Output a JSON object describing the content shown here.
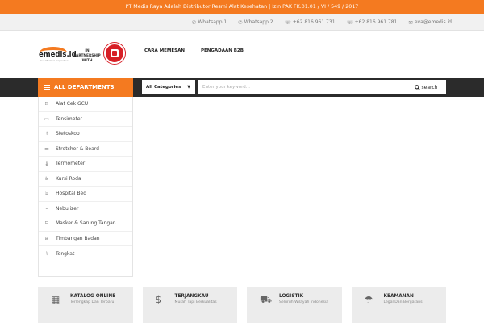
{
  "topbar": {
    "text": "PT Medis Raya Adalah Distributor Resmi Alat Kesehatan | Izin PAK FK.01.01 / VI / 549 / 2017"
  },
  "contacts": [
    {
      "icon": "whatsapp-icon",
      "glyph": "✆",
      "label": "Whatsapp 1"
    },
    {
      "icon": "whatsapp-icon",
      "glyph": "✆",
      "label": "Whatsapp 2"
    },
    {
      "icon": "phone-icon",
      "glyph": "☏",
      "label": "+62 816 961 731"
    },
    {
      "icon": "phone-icon",
      "glyph": "☏",
      "label": "+62 816 961 781"
    },
    {
      "icon": "mail-icon",
      "glyph": "✉",
      "label": "eva@emedis.id"
    }
  ],
  "logo": {
    "word": "emedis.id",
    "tagline": "Your Medical Inspiration"
  },
  "partner": {
    "line1": "IN PARTNERSHIP",
    "line2": "WITH"
  },
  "nav": [
    {
      "label": "CARA MEMESAN"
    },
    {
      "label": "PENGADAAN B2B"
    }
  ],
  "departments": {
    "label": "ALL DEPARTMENTS"
  },
  "search": {
    "category": "All Categories",
    "placeholder": "Enter your keyword...",
    "button": "search"
  },
  "categories": [
    {
      "label": "Alat Cek GCU",
      "icon": "glucose-meter-icon",
      "glyph": "⊡"
    },
    {
      "label": "Tensimeter",
      "icon": "tensimeter-icon",
      "glyph": "▭"
    },
    {
      "label": "Stetoskop",
      "icon": "stethoscope-icon",
      "glyph": "⚕"
    },
    {
      "label": "Stretcher & Board",
      "icon": "stretcher-icon",
      "glyph": "▬"
    },
    {
      "label": "Termometer",
      "icon": "thermometer-icon",
      "glyph": "🌡"
    },
    {
      "label": "Kursi Roda",
      "icon": "wheelchair-icon",
      "glyph": "♿"
    },
    {
      "label": "Hospital Bed",
      "icon": "bed-icon",
      "glyph": "⌸"
    },
    {
      "label": "Nebulizer",
      "icon": "nebulizer-icon",
      "glyph": "⌁"
    },
    {
      "label": "Masker & Sarung Tangan",
      "icon": "mask-icon",
      "glyph": "⊟"
    },
    {
      "label": "Timbangan Badan",
      "icon": "scale-icon",
      "glyph": "⊞"
    },
    {
      "label": "Tongkat",
      "icon": "cane-icon",
      "glyph": "⌇"
    }
  ],
  "features": [
    {
      "title": "KATALOG ONLINE",
      "subtitle": "Terlengkap Dan Terbaru",
      "icon": "calendar-icon",
      "glyph": "▦"
    },
    {
      "title": "TERJANGKAU",
      "subtitle": "Murah Tapi Berkualitas",
      "icon": "money-icon",
      "glyph": "$"
    },
    {
      "title": "LOGISTIK",
      "subtitle": "Seluruh Wilayah Indonesia",
      "icon": "truck-icon",
      "glyph": "⛟"
    },
    {
      "title": "KEAMANAN",
      "subtitle": "Legal Dan Bergaransi",
      "icon": "umbrella-icon",
      "glyph": "☂"
    }
  ],
  "colors": {
    "accent": "#f47a20",
    "dark": "#2b2b2b",
    "seal": "#d71f26"
  }
}
